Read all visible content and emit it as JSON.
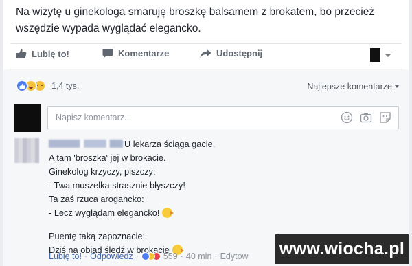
{
  "post": {
    "text": "Na wizytę u ginekologa smaruję broszkę balsamem z brokatem, bo przecież wszędzie wypada wyglądać elegancko."
  },
  "actions": {
    "like_label": "Lubię to!",
    "comment_label": "Komentarze",
    "share_label": "Udostępnij"
  },
  "reactions": {
    "count_label": "1,4 tys.",
    "icons": [
      "like-reaction-icon",
      "haha-reaction-icon",
      "sad-reaction-icon"
    ]
  },
  "sort": {
    "label": "Najlepsze komentarze"
  },
  "comment_input": {
    "placeholder": "Napisz komentarz..."
  },
  "comment": {
    "lines": [
      "U lekarza ściąga gacie,",
      "A tam 'broszka' jej w brokacie.",
      "Ginekolog krzyczy, piszczy:",
      "- Twa muszelka strasznie błyszczy!",
      "Ta zaś rzuca arogancko:",
      "- Lecz wyglądam elegancko!",
      "Puentę taką zapoznacie:",
      "Dziś na obiad śledź w brokacie"
    ],
    "meta": {
      "like_label": "Lubię to!",
      "reply_label": "Odpowiedz",
      "reaction_count": "559",
      "time": "40 min",
      "edited_label": "Edytow"
    }
  },
  "watermark": {
    "text": "www.wiocha.pl"
  },
  "colors": {
    "link": "#4267b2",
    "muted": "#606770",
    "comment_bg": "#f6f7f9",
    "like_blue": "#4e7df0"
  }
}
